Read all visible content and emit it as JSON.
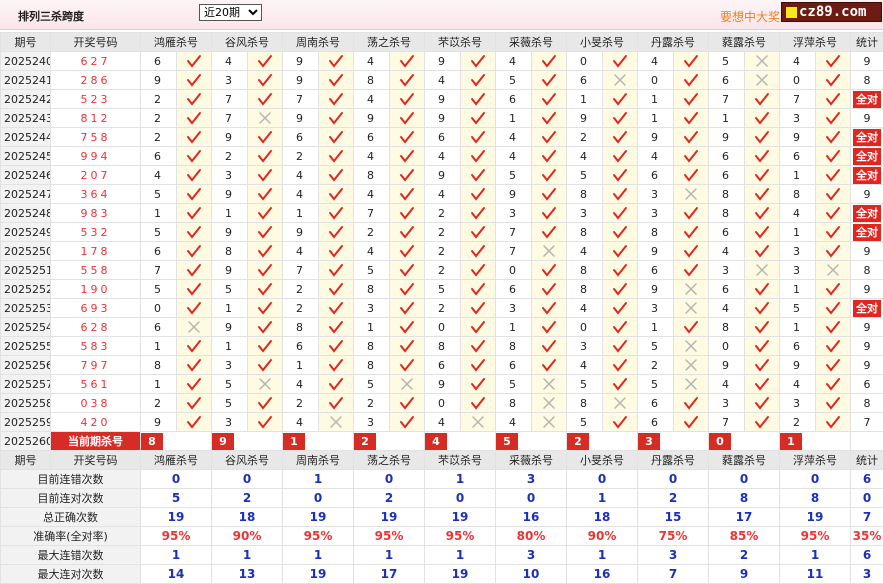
{
  "header": {
    "title": "排列三杀跨度",
    "period_select": "近20期",
    "promo": "要想中大奖",
    "logo": "cz89.com"
  },
  "columns": {
    "qihao": "期号",
    "kaijiang": "开奖号码",
    "killers": [
      "鸿雁杀号",
      "谷风杀号",
      "周南杀号",
      "荡之杀号",
      "芣苡杀号",
      "采薇杀号",
      "小旻杀号",
      "丹露杀号",
      "蕤露杀号",
      "浮萍杀号"
    ],
    "tongji": "统计"
  },
  "rows": [
    {
      "qi": "2025240",
      "kj": "627",
      "v": [
        [
          "6",
          "y"
        ],
        [
          "4",
          "y"
        ],
        [
          "9",
          "y"
        ],
        [
          "4",
          "y"
        ],
        [
          "9",
          "y"
        ],
        [
          "4",
          "y"
        ],
        [
          "0",
          "y"
        ],
        [
          "4",
          "y"
        ],
        [
          "5",
          "x"
        ],
        [
          "4",
          "y"
        ]
      ],
      "tj": "9"
    },
    {
      "qi": "2025241",
      "kj": "286",
      "v": [
        [
          "9",
          "y"
        ],
        [
          "3",
          "y"
        ],
        [
          "9",
          "y"
        ],
        [
          "8",
          "y"
        ],
        [
          "4",
          "y"
        ],
        [
          "5",
          "y"
        ],
        [
          "6",
          "x"
        ],
        [
          "0",
          "y"
        ],
        [
          "6",
          "x"
        ],
        [
          "0",
          "y"
        ]
      ],
      "tj": "8"
    },
    {
      "qi": "2025242",
      "kj": "523",
      "v": [
        [
          "2",
          "y"
        ],
        [
          "7",
          "y"
        ],
        [
          "7",
          "y"
        ],
        [
          "4",
          "y"
        ],
        [
          "9",
          "y"
        ],
        [
          "6",
          "y"
        ],
        [
          "1",
          "y"
        ],
        [
          "1",
          "y"
        ],
        [
          "7",
          "y"
        ],
        [
          "7",
          "y"
        ]
      ],
      "tj": "全对"
    },
    {
      "qi": "2025243",
      "kj": "812",
      "v": [
        [
          "2",
          "y"
        ],
        [
          "7",
          "x"
        ],
        [
          "9",
          "y"
        ],
        [
          "9",
          "y"
        ],
        [
          "9",
          "y"
        ],
        [
          "1",
          "y"
        ],
        [
          "9",
          "y"
        ],
        [
          "1",
          "y"
        ],
        [
          "1",
          "y"
        ],
        [
          "3",
          "y"
        ]
      ],
      "tj": "9"
    },
    {
      "qi": "2025244",
      "kj": "758",
      "v": [
        [
          "2",
          "y"
        ],
        [
          "9",
          "y"
        ],
        [
          "6",
          "y"
        ],
        [
          "6",
          "y"
        ],
        [
          "6",
          "y"
        ],
        [
          "4",
          "y"
        ],
        [
          "2",
          "y"
        ],
        [
          "9",
          "y"
        ],
        [
          "9",
          "y"
        ],
        [
          "9",
          "y"
        ]
      ],
      "tj": "全对"
    },
    {
      "qi": "2025245",
      "kj": "994",
      "v": [
        [
          "6",
          "y"
        ],
        [
          "2",
          "y"
        ],
        [
          "2",
          "y"
        ],
        [
          "4",
          "y"
        ],
        [
          "4",
          "y"
        ],
        [
          "4",
          "y"
        ],
        [
          "4",
          "y"
        ],
        [
          "4",
          "y"
        ],
        [
          "6",
          "y"
        ],
        [
          "6",
          "y"
        ]
      ],
      "tj": "全对"
    },
    {
      "qi": "2025246",
      "kj": "207",
      "v": [
        [
          "4",
          "y"
        ],
        [
          "3",
          "y"
        ],
        [
          "4",
          "y"
        ],
        [
          "8",
          "y"
        ],
        [
          "9",
          "y"
        ],
        [
          "5",
          "y"
        ],
        [
          "5",
          "y"
        ],
        [
          "6",
          "y"
        ],
        [
          "6",
          "y"
        ],
        [
          "1",
          "y"
        ]
      ],
      "tj": "全对"
    },
    {
      "qi": "2025247",
      "kj": "364",
      "v": [
        [
          "5",
          "y"
        ],
        [
          "9",
          "y"
        ],
        [
          "4",
          "y"
        ],
        [
          "4",
          "y"
        ],
        [
          "4",
          "y"
        ],
        [
          "9",
          "y"
        ],
        [
          "8",
          "y"
        ],
        [
          "3",
          "x"
        ],
        [
          "8",
          "y"
        ],
        [
          "8",
          "y"
        ]
      ],
      "tj": "9"
    },
    {
      "qi": "2025248",
      "kj": "983",
      "v": [
        [
          "1",
          "y"
        ],
        [
          "1",
          "y"
        ],
        [
          "1",
          "y"
        ],
        [
          "7",
          "y"
        ],
        [
          "2",
          "y"
        ],
        [
          "3",
          "y"
        ],
        [
          "3",
          "y"
        ],
        [
          "3",
          "y"
        ],
        [
          "8",
          "y"
        ],
        [
          "4",
          "y"
        ]
      ],
      "tj": "全对"
    },
    {
      "qi": "2025249",
      "kj": "532",
      "v": [
        [
          "5",
          "y"
        ],
        [
          "9",
          "y"
        ],
        [
          "9",
          "y"
        ],
        [
          "2",
          "y"
        ],
        [
          "2",
          "y"
        ],
        [
          "7",
          "y"
        ],
        [
          "8",
          "y"
        ],
        [
          "8",
          "y"
        ],
        [
          "6",
          "y"
        ],
        [
          "1",
          "y"
        ]
      ],
      "tj": "全对"
    },
    {
      "qi": "2025250",
      "kj": "178",
      "v": [
        [
          "6",
          "y"
        ],
        [
          "8",
          "y"
        ],
        [
          "4",
          "y"
        ],
        [
          "4",
          "y"
        ],
        [
          "2",
          "y"
        ],
        [
          "7",
          "x"
        ],
        [
          "4",
          "y"
        ],
        [
          "9",
          "y"
        ],
        [
          "4",
          "y"
        ],
        [
          "3",
          "y"
        ]
      ],
      "tj": "9"
    },
    {
      "qi": "2025251",
      "kj": "558",
      "v": [
        [
          "7",
          "y"
        ],
        [
          "9",
          "y"
        ],
        [
          "7",
          "y"
        ],
        [
          "5",
          "y"
        ],
        [
          "2",
          "y"
        ],
        [
          "0",
          "y"
        ],
        [
          "8",
          "y"
        ],
        [
          "6",
          "y"
        ],
        [
          "3",
          "x"
        ],
        [
          "3",
          "x"
        ]
      ],
      "tj": "8"
    },
    {
      "qi": "2025252",
      "kj": "190",
      "v": [
        [
          "5",
          "y"
        ],
        [
          "5",
          "y"
        ],
        [
          "2",
          "y"
        ],
        [
          "8",
          "y"
        ],
        [
          "5",
          "y"
        ],
        [
          "6",
          "y"
        ],
        [
          "8",
          "y"
        ],
        [
          "9",
          "x"
        ],
        [
          "6",
          "y"
        ],
        [
          "1",
          "y"
        ]
      ],
      "tj": "9"
    },
    {
      "qi": "2025253",
      "kj": "693",
      "v": [
        [
          "0",
          "y"
        ],
        [
          "1",
          "y"
        ],
        [
          "2",
          "y"
        ],
        [
          "3",
          "y"
        ],
        [
          "2",
          "y"
        ],
        [
          "3",
          "y"
        ],
        [
          "4",
          "y"
        ],
        [
          "3",
          "x"
        ],
        [
          "4",
          "y"
        ],
        [
          "5",
          "y"
        ]
      ],
      "tj": "全对"
    },
    {
      "qi": "2025254",
      "kj": "628",
      "v": [
        [
          "6",
          "x"
        ],
        [
          "9",
          "y"
        ],
        [
          "8",
          "y"
        ],
        [
          "1",
          "y"
        ],
        [
          "0",
          "y"
        ],
        [
          "1",
          "y"
        ],
        [
          "0",
          "y"
        ],
        [
          "1",
          "y"
        ],
        [
          "8",
          "y"
        ],
        [
          "1",
          "y"
        ]
      ],
      "tj": "9"
    },
    {
      "qi": "2025255",
      "kj": "583",
      "v": [
        [
          "1",
          "y"
        ],
        [
          "1",
          "y"
        ],
        [
          "6",
          "y"
        ],
        [
          "8",
          "y"
        ],
        [
          "8",
          "y"
        ],
        [
          "8",
          "y"
        ],
        [
          "3",
          "y"
        ],
        [
          "5",
          "x"
        ],
        [
          "0",
          "y"
        ],
        [
          "6",
          "y"
        ]
      ],
      "tj": "9"
    },
    {
      "qi": "2025256",
      "kj": "797",
      "v": [
        [
          "8",
          "y"
        ],
        [
          "3",
          "y"
        ],
        [
          "1",
          "y"
        ],
        [
          "8",
          "y"
        ],
        [
          "6",
          "y"
        ],
        [
          "6",
          "y"
        ],
        [
          "4",
          "y"
        ],
        [
          "2",
          "x"
        ],
        [
          "9",
          "y"
        ],
        [
          "9",
          "y"
        ]
      ],
      "tj": "9"
    },
    {
      "qi": "2025257",
      "kj": "561",
      "v": [
        [
          "1",
          "y"
        ],
        [
          "5",
          "x"
        ],
        [
          "4",
          "y"
        ],
        [
          "5",
          "x"
        ],
        [
          "9",
          "y"
        ],
        [
          "5",
          "x"
        ],
        [
          "5",
          "y"
        ],
        [
          "5",
          "x"
        ],
        [
          "4",
          "y"
        ],
        [
          "4",
          "y"
        ]
      ],
      "tj": "6"
    },
    {
      "qi": "2025258",
      "kj": "038",
      "v": [
        [
          "2",
          "y"
        ],
        [
          "5",
          "y"
        ],
        [
          "2",
          "y"
        ],
        [
          "2",
          "y"
        ],
        [
          "0",
          "y"
        ],
        [
          "8",
          "x"
        ],
        [
          "8",
          "x"
        ],
        [
          "6",
          "y"
        ],
        [
          "3",
          "y"
        ],
        [
          "3",
          "y"
        ]
      ],
      "tj": "8"
    },
    {
      "qi": "2025259",
      "kj": "420",
      "v": [
        [
          "9",
          "y"
        ],
        [
          "3",
          "y"
        ],
        [
          "4",
          "x"
        ],
        [
          "3",
          "y"
        ],
        [
          "4",
          "x"
        ],
        [
          "4",
          "x"
        ],
        [
          "5",
          "y"
        ],
        [
          "6",
          "y"
        ],
        [
          "7",
          "y"
        ],
        [
          "2",
          "y"
        ]
      ],
      "tj": "7"
    }
  ],
  "current": {
    "qi": "2025260",
    "label": "当前期杀号",
    "values": [
      "8",
      "9",
      "1",
      "2",
      "4",
      "5",
      "2",
      "3",
      "0",
      "1"
    ]
  },
  "stats": [
    {
      "label": "目前连错次数",
      "values": [
        "0",
        "0",
        "1",
        "0",
        "1",
        "3",
        "0",
        "0",
        "0",
        "0"
      ],
      "tj": "6",
      "pct": false
    },
    {
      "label": "目前连对次数",
      "values": [
        "5",
        "2",
        "0",
        "2",
        "0",
        "0",
        "1",
        "2",
        "8",
        "8"
      ],
      "tj": "0",
      "pct": false
    },
    {
      "label": "总正确次数",
      "values": [
        "19",
        "18",
        "19",
        "19",
        "19",
        "16",
        "18",
        "15",
        "17",
        "19"
      ],
      "tj": "7",
      "pct": false
    },
    {
      "label": "准确率(全对率)",
      "values": [
        "95%",
        "90%",
        "95%",
        "95%",
        "95%",
        "80%",
        "90%",
        "75%",
        "85%",
        "95%"
      ],
      "tj": "35%",
      "pct": true
    },
    {
      "label": "最大连错次数",
      "values": [
        "1",
        "1",
        "1",
        "1",
        "1",
        "3",
        "1",
        "3",
        "2",
        "1"
      ],
      "tj": "6",
      "pct": false
    },
    {
      "label": "最大连对次数",
      "values": [
        "14",
        "13",
        "19",
        "17",
        "19",
        "10",
        "16",
        "7",
        "9",
        "11"
      ],
      "tj": "3",
      "pct": false
    }
  ],
  "colors": {
    "accent": "#e0261f",
    "correct": "#e0261f",
    "wrong": "#b5b5b5",
    "stat_blue": "#1a2fbd",
    "highlight": "#fffbe3"
  },
  "icons": {
    "correct": "check-icon",
    "wrong": "cross-icon"
  }
}
